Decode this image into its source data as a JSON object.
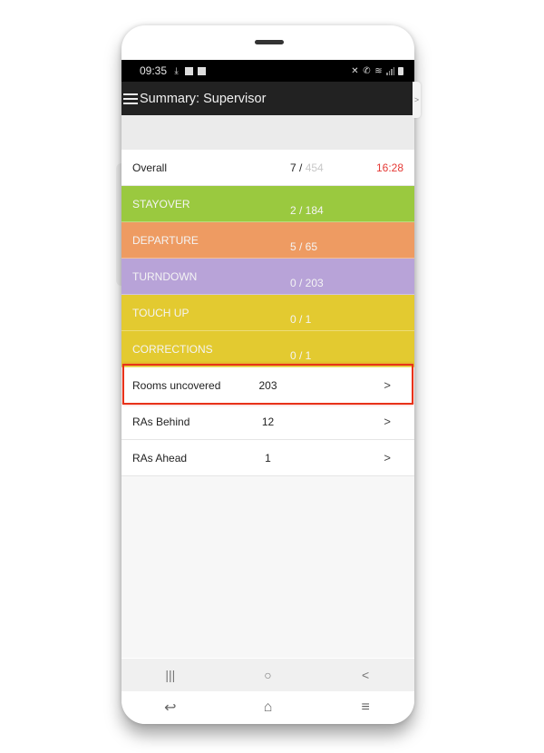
{
  "status_bar": {
    "time": "09:35",
    "left_icons": [
      "download-icon",
      "image-icon",
      "checkbox-icon"
    ],
    "right_icons": [
      "mute-icon",
      "wifi-calling-icon",
      "wifi-icon",
      "signal-icon",
      "battery-icon"
    ]
  },
  "app_bar": {
    "menu_icon": "hamburger-icon",
    "title": "Summary: Supervisor"
  },
  "overall": {
    "label": "Overall",
    "done": "7 /",
    "total": "454",
    "time": "16:28"
  },
  "categories": [
    {
      "label": "STAYOVER",
      "value": "2 / 184",
      "color": "#9ac93f"
    },
    {
      "label": "DEPARTURE",
      "value": "5 / 65",
      "color": "#ee9b62"
    },
    {
      "label": "TURNDOWN",
      "value": "0 / 203",
      "color": "#b8a3d8"
    },
    {
      "label": "TOUCH UP",
      "value": "0 / 1",
      "color": "#e3ca30"
    },
    {
      "label": "CORRECTIONS",
      "value": "0 / 1",
      "color": "#e3ca30"
    }
  ],
  "details": [
    {
      "label": "Rooms uncovered",
      "value": "203",
      "chevron": ">",
      "highlighted": true
    },
    {
      "label": "RAs Behind",
      "value": "12",
      "chevron": ">"
    },
    {
      "label": "RAs Ahead",
      "value": "1",
      "chevron": ">"
    }
  ],
  "android_nav": {
    "recents": "|||",
    "home": "○",
    "back": "<"
  },
  "device_nav": {
    "back": "↩",
    "home": "⌂",
    "menu": "≡"
  },
  "side_tab": ">",
  "highlight_color": "#e8321a"
}
